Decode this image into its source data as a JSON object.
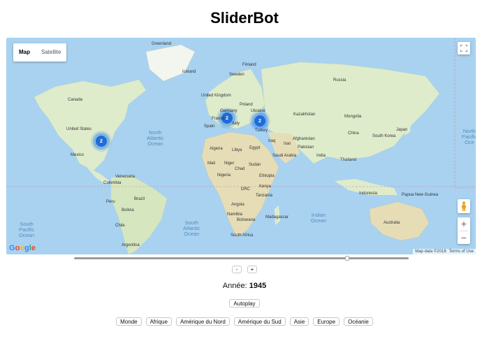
{
  "app": {
    "title": "SliderBot"
  },
  "map": {
    "type_options": [
      "Map",
      "Satellite"
    ],
    "active_type": "Map",
    "countries": [
      "Greenland",
      "Iceland",
      "Sweden",
      "Finland",
      "Russia",
      "United Kingdom",
      "Poland",
      "Germany",
      "France",
      "Ukraine",
      "Spain",
      "Italy",
      "Turkey",
      "Kazakhstan",
      "Mongolia",
      "Canada",
      "United States",
      "Mexico",
      "Iraq",
      "Iran",
      "Afghanistan",
      "China",
      "South Korea",
      "Japan",
      "Algeria",
      "Libya",
      "Egypt",
      "Saudi Arabia",
      "Pakistan",
      "India",
      "Mali",
      "Niger",
      "Chad",
      "Sudan",
      "Thailand",
      "Nigeria",
      "Ethiopia",
      "Venezuela",
      "Colombia",
      "DRC",
      "Kenya",
      "Tanzania",
      "Brazil",
      "Peru",
      "Bolivia",
      "Angola",
      "Namibia",
      "Botswana",
      "Madagascar",
      "Indonesia",
      "Papua New Guinea",
      "Australia",
      "Chile",
      "South Africa",
      "Argentina"
    ],
    "oceans": [
      "North\nAtlantic\nOcean",
      "North\nPacific\nOce",
      "South\nPacific\nOcean",
      "South\nAtlantic\nOcean",
      "Indian\nOcean"
    ],
    "clusters": [
      {
        "region": "north-america",
        "count": "2"
      },
      {
        "region": "western-europe",
        "count": "2"
      },
      {
        "region": "eastern-europe",
        "count": "2"
      }
    ],
    "google_logo": "Google",
    "attribution": {
      "data": "Map data ©2018",
      "terms": "Terms of Use"
    },
    "icons": {
      "fullscreen": "fullscreen-icon",
      "pegman": "pegman-icon",
      "zoom_in": "+",
      "zoom_out": "−"
    }
  },
  "slider": {
    "position_fraction": 0.82
  },
  "steps": {
    "minus": "-",
    "plus": "+"
  },
  "year": {
    "label": "Année:",
    "value": "1945"
  },
  "autoplay": {
    "label": "Autoplay"
  },
  "regions": [
    "Monde",
    "Afrique",
    "Amérique du Nord",
    "Amérique du Sud",
    "Asie",
    "Europe",
    "Océanie"
  ],
  "colors": {
    "water": "#a8d2f0",
    "land": "#dfeccb",
    "cluster": "#1e6cd8"
  }
}
